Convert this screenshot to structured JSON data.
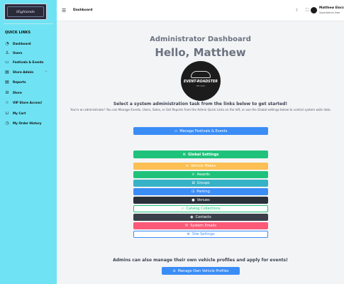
{
  "sidebar": {
    "brand": "Highlands",
    "quick_links_title": "QUICK LINKS",
    "items": [
      {
        "label": "Dashboard",
        "icon": "dashboard-icon"
      },
      {
        "label": "Users",
        "icon": "user-icon"
      },
      {
        "label": "Festivals & Events",
        "icon": "calendar-icon"
      },
      {
        "label": "Store Admin",
        "icon": "store-icon"
      },
      {
        "label": "Reports",
        "icon": "reports-icon"
      },
      {
        "label": "Store",
        "icon": "store-front-icon"
      },
      {
        "label": "VIP Store Access!",
        "icon": "star-icon"
      },
      {
        "label": "My Cart",
        "icon": "cart-icon"
      },
      {
        "label": "My Order History",
        "icon": "history-icon"
      }
    ]
  },
  "topbar": {
    "title": "Dashboard",
    "user_name": "Matthew Elorz",
    "user_role": "SuperAdmin User"
  },
  "main": {
    "admin_heading": "Administrator Dashboard",
    "hello_heading": "Hello, Matthew",
    "logo_text": "EVENT-ROADSTER",
    "logo_sub": "EST 2023",
    "select_task": "Select a system administration task from the links below to get started!",
    "intro_text": "You're an administrator! You can Manage Events, Users, Sales, or Get Reports from the Admin Quick Links on the left, or use the Global settings below to control system wide data.",
    "manage_festivals": "Manage Festivals & Events",
    "global_settings": "Global Settings",
    "vehicle_makes": "Vehicle Makes",
    "awards": "Awards",
    "groups": "Groups",
    "parking": "Parking",
    "venues": "Venues",
    "catalog_collections": "Catalog Collections",
    "contacts": "Contacts",
    "system_emails": "System Emails",
    "site_settings": "Site Settings",
    "admins_text": "Admins can also manage their own vehicle profiles and apply for events!",
    "manage_vehicles": "Manage Own Vehicle Profiles"
  },
  "colors": {
    "sidebar": "#6fe3f3",
    "primary": "#3b8df6",
    "success": "#1fc27a",
    "warning": "#fbbf53",
    "info": "#36b2c6",
    "dark": "#2b313b",
    "danger": "#fa5a78"
  }
}
